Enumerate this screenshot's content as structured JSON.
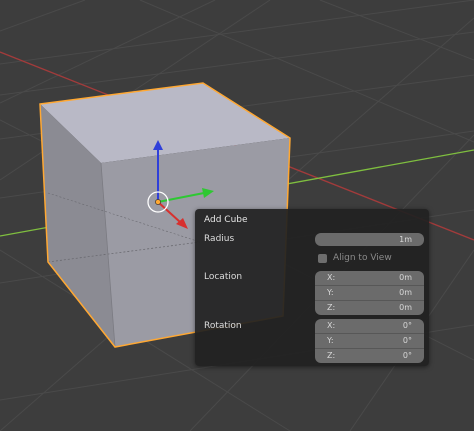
{
  "redo_panel": {
    "title": "Add Cube",
    "radius": {
      "label": "Radius",
      "value": "1m"
    },
    "align_to_view": {
      "label": "Align to View",
      "checked": false
    },
    "location": {
      "label": "Location",
      "x": {
        "label": "X:",
        "value": "0m"
      },
      "y": {
        "label": "Y:",
        "value": "0m"
      },
      "z": {
        "label": "Z:",
        "value": "0m"
      }
    },
    "rotation": {
      "label": "Rotation",
      "x": {
        "label": "X:",
        "value": "0°"
      },
      "y": {
        "label": "Y:",
        "value": "0°"
      },
      "z": {
        "label": "Z:",
        "value": "0°"
      }
    }
  },
  "colors": {
    "background": "#3d3d3d",
    "grid": "#4a4a4a",
    "x_axis": "#a23b3b",
    "y_axis": "#7fbf3f",
    "selection_outline": "#ffa833",
    "cube_top": "#b9b9c6",
    "cube_front": "#9b9ba4",
    "cube_left": "#8a8a92",
    "gizmo_x": "#d7302e",
    "gizmo_y": "#2ec832",
    "gizmo_z": "#2f3fd9"
  }
}
